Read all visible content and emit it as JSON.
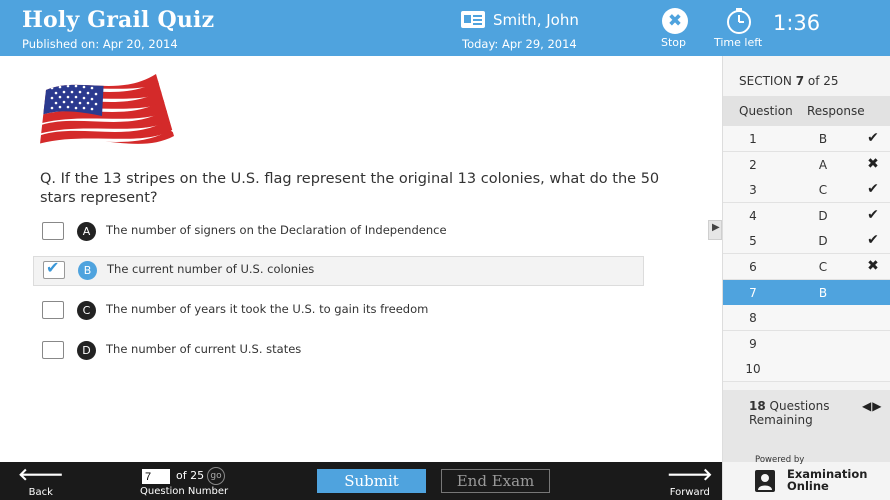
{
  "header": {
    "quiz_title": "Holy Grail Quiz",
    "published": "Published on: Apr 20, 2014",
    "user_name": "Smith, John",
    "today": "Today: Apr 29, 2014",
    "stop_label": "Stop",
    "time_left_label": "Time left",
    "time_value": "1:36"
  },
  "question": {
    "text": "Q. If the 13 stripes on the U.S. flag represent the original 13 colonies, what do the 50 stars represent?",
    "image": "us-flag",
    "choices": [
      {
        "letter": "A",
        "text": "The number of signers on the Declaration of Independence",
        "selected": false
      },
      {
        "letter": "B",
        "text": "The current number of U.S. colonies",
        "selected": true
      },
      {
        "letter": "C",
        "text": "The number of years it took the U.S. to gain its freedom",
        "selected": false
      },
      {
        "letter": "D",
        "text": "The number of current U.S. states",
        "selected": false
      }
    ]
  },
  "sidebar": {
    "section_prefix": "SECTION",
    "section_number": "7",
    "section_total": "of 25",
    "col_question": "Question",
    "col_response": "Response",
    "rows": [
      {
        "num": "1",
        "resp": "B",
        "mark": "✔"
      },
      {
        "num": "2",
        "resp": "A",
        "mark": "✖"
      },
      {
        "num": "3",
        "resp": "C",
        "mark": "✔"
      },
      {
        "num": "4",
        "resp": "D",
        "mark": "✔"
      },
      {
        "num": "5",
        "resp": "D",
        "mark": "✔"
      },
      {
        "num": "6",
        "resp": "C",
        "mark": "✖"
      },
      {
        "num": "7",
        "resp": "B",
        "mark": ""
      },
      {
        "num": "8",
        "resp": "",
        "mark": ""
      },
      {
        "num": "9",
        "resp": "",
        "mark": ""
      },
      {
        "num": "10",
        "resp": "",
        "mark": ""
      }
    ],
    "current_row": "7",
    "remaining_count": "18",
    "remaining_word": "Questions",
    "remaining_word2": "Remaining"
  },
  "footer": {
    "back_label": "Back",
    "forward_label": "Forward",
    "question_number_value": "7",
    "of_total": "of 25",
    "go_label": "go",
    "question_number_label": "Question Number",
    "submit_label": "Submit",
    "end_exam_label": "End Exam"
  },
  "branding": {
    "powered_by": "Powered by",
    "name_line1": "Examination",
    "name_line2": "Online"
  },
  "colors": {
    "accent": "#4fa3de",
    "footer_bg": "#1a1a1a"
  }
}
